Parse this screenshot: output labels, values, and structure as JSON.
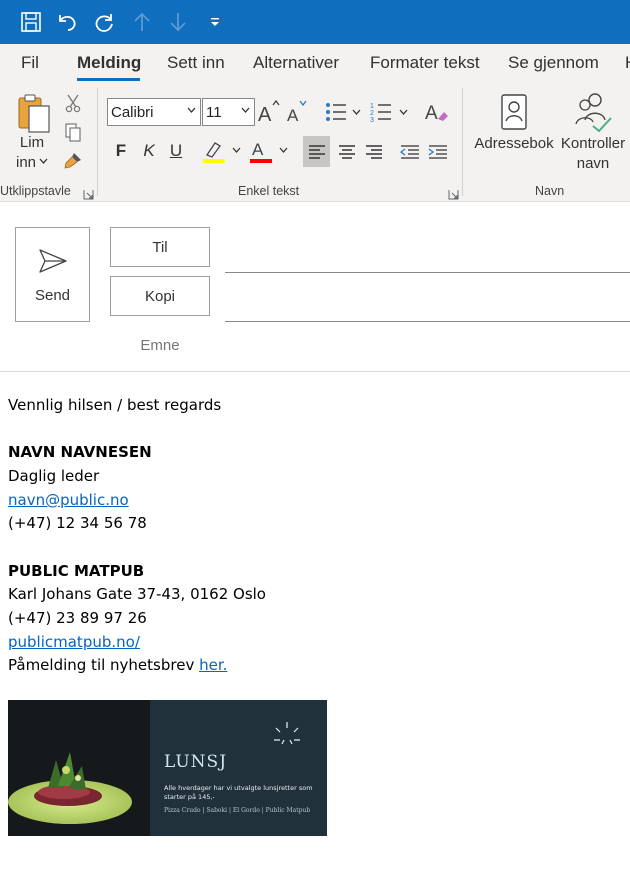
{
  "ribbon_tabs": [
    {
      "label": "Fil"
    },
    {
      "label": "Melding"
    },
    {
      "label": "Sett inn"
    },
    {
      "label": "Alternativer"
    },
    {
      "label": "Formater tekst"
    },
    {
      "label": "Se gjennom"
    },
    {
      "label": "H"
    }
  ],
  "clipboard": {
    "paste_label_line1": "Lim",
    "paste_label_line2": "inn",
    "group_label": "Utklippstavle"
  },
  "basic_text": {
    "font_name": "Calibri",
    "font_size": "11",
    "bold_label": "F",
    "italic_label": "K",
    "underline_label": "U",
    "group_label": "Enkel tekst",
    "highlight_color": "#ffff00",
    "font_color": "#ff0000"
  },
  "names": {
    "address_book_label": "Adressebok",
    "check_names_line1": "Kontroller",
    "check_names_line2": "navn",
    "group_label": "Navn"
  },
  "compose": {
    "send_label": "Send",
    "to_label": "Til",
    "cc_label": "Kopi",
    "subject_label": "Emne"
  },
  "body": {
    "greeting": "Vennlig hilsen / best regards",
    "name": "NAVN NAVNESEN",
    "role": "Daglig leder",
    "email": "navn@public.no",
    "phone": "(+47) 12 34 56 78",
    "company": "PUBLIC MATPUB",
    "address": "Karl Johans Gate 37-43, 0162 Oslo",
    "company_phone": "(+47) 23 89 97 26",
    "website": "publicmatpub.no/",
    "newsletter_text": "Påmelding til nyhetsbrev ",
    "newsletter_link": "her."
  },
  "banner": {
    "title": "LUNSJ",
    "description": "Alle hverdager har vi utvalgte lunsjretter som starter på 145,-",
    "footer": "Pizza Crudo | Saboki | El Gordo | Public Matpub"
  },
  "colors": {
    "accent": "#106ebe",
    "link": "#0563c1"
  }
}
